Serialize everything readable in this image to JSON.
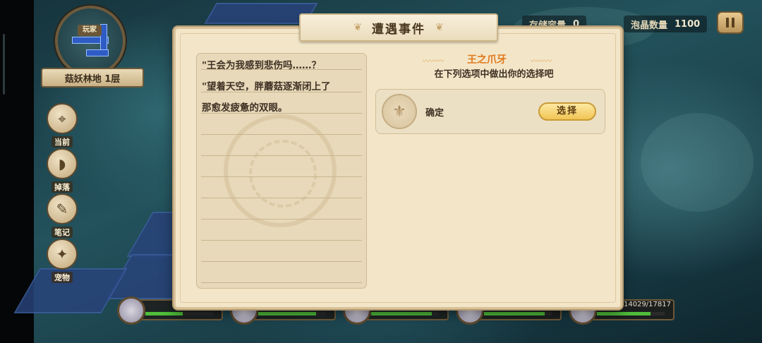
{
  "hud": {
    "stat1_label": "存储容量",
    "stat1_value": "0",
    "stat2_label": "泡晶数量",
    "stat2_value": "1100"
  },
  "minimap": {
    "tag": "玩家",
    "floor": "菇妖林地 1层"
  },
  "side_menu": [
    {
      "label": "当前",
      "icon": "location-pin-icon"
    },
    {
      "label": "掉落",
      "icon": "loot-bag-icon"
    },
    {
      "label": "笔记",
      "icon": "scroll-icon"
    },
    {
      "label": "宠物",
      "icon": "pet-book-icon"
    }
  ],
  "party": {
    "hp_readout": "14029/17817",
    "members": [
      {
        "hp_fraction": 0.55
      },
      {
        "hp_fraction": 0.85
      },
      {
        "hp_fraction": 0.9
      },
      {
        "hp_fraction": 0.9
      },
      {
        "hp_fraction": 0.79
      }
    ]
  },
  "dialog": {
    "title": "遭遇事件",
    "story": "\"王会为我感到悲伤吗……？\n\"望着天空，胖蘑菇逐渐闭上了\n那愈发疲惫的双眼。",
    "event_name": "王之爪牙",
    "prompt": "在下列选项中做出你的选择吧",
    "options": [
      {
        "label": "确定",
        "button": "选择"
      }
    ]
  }
}
